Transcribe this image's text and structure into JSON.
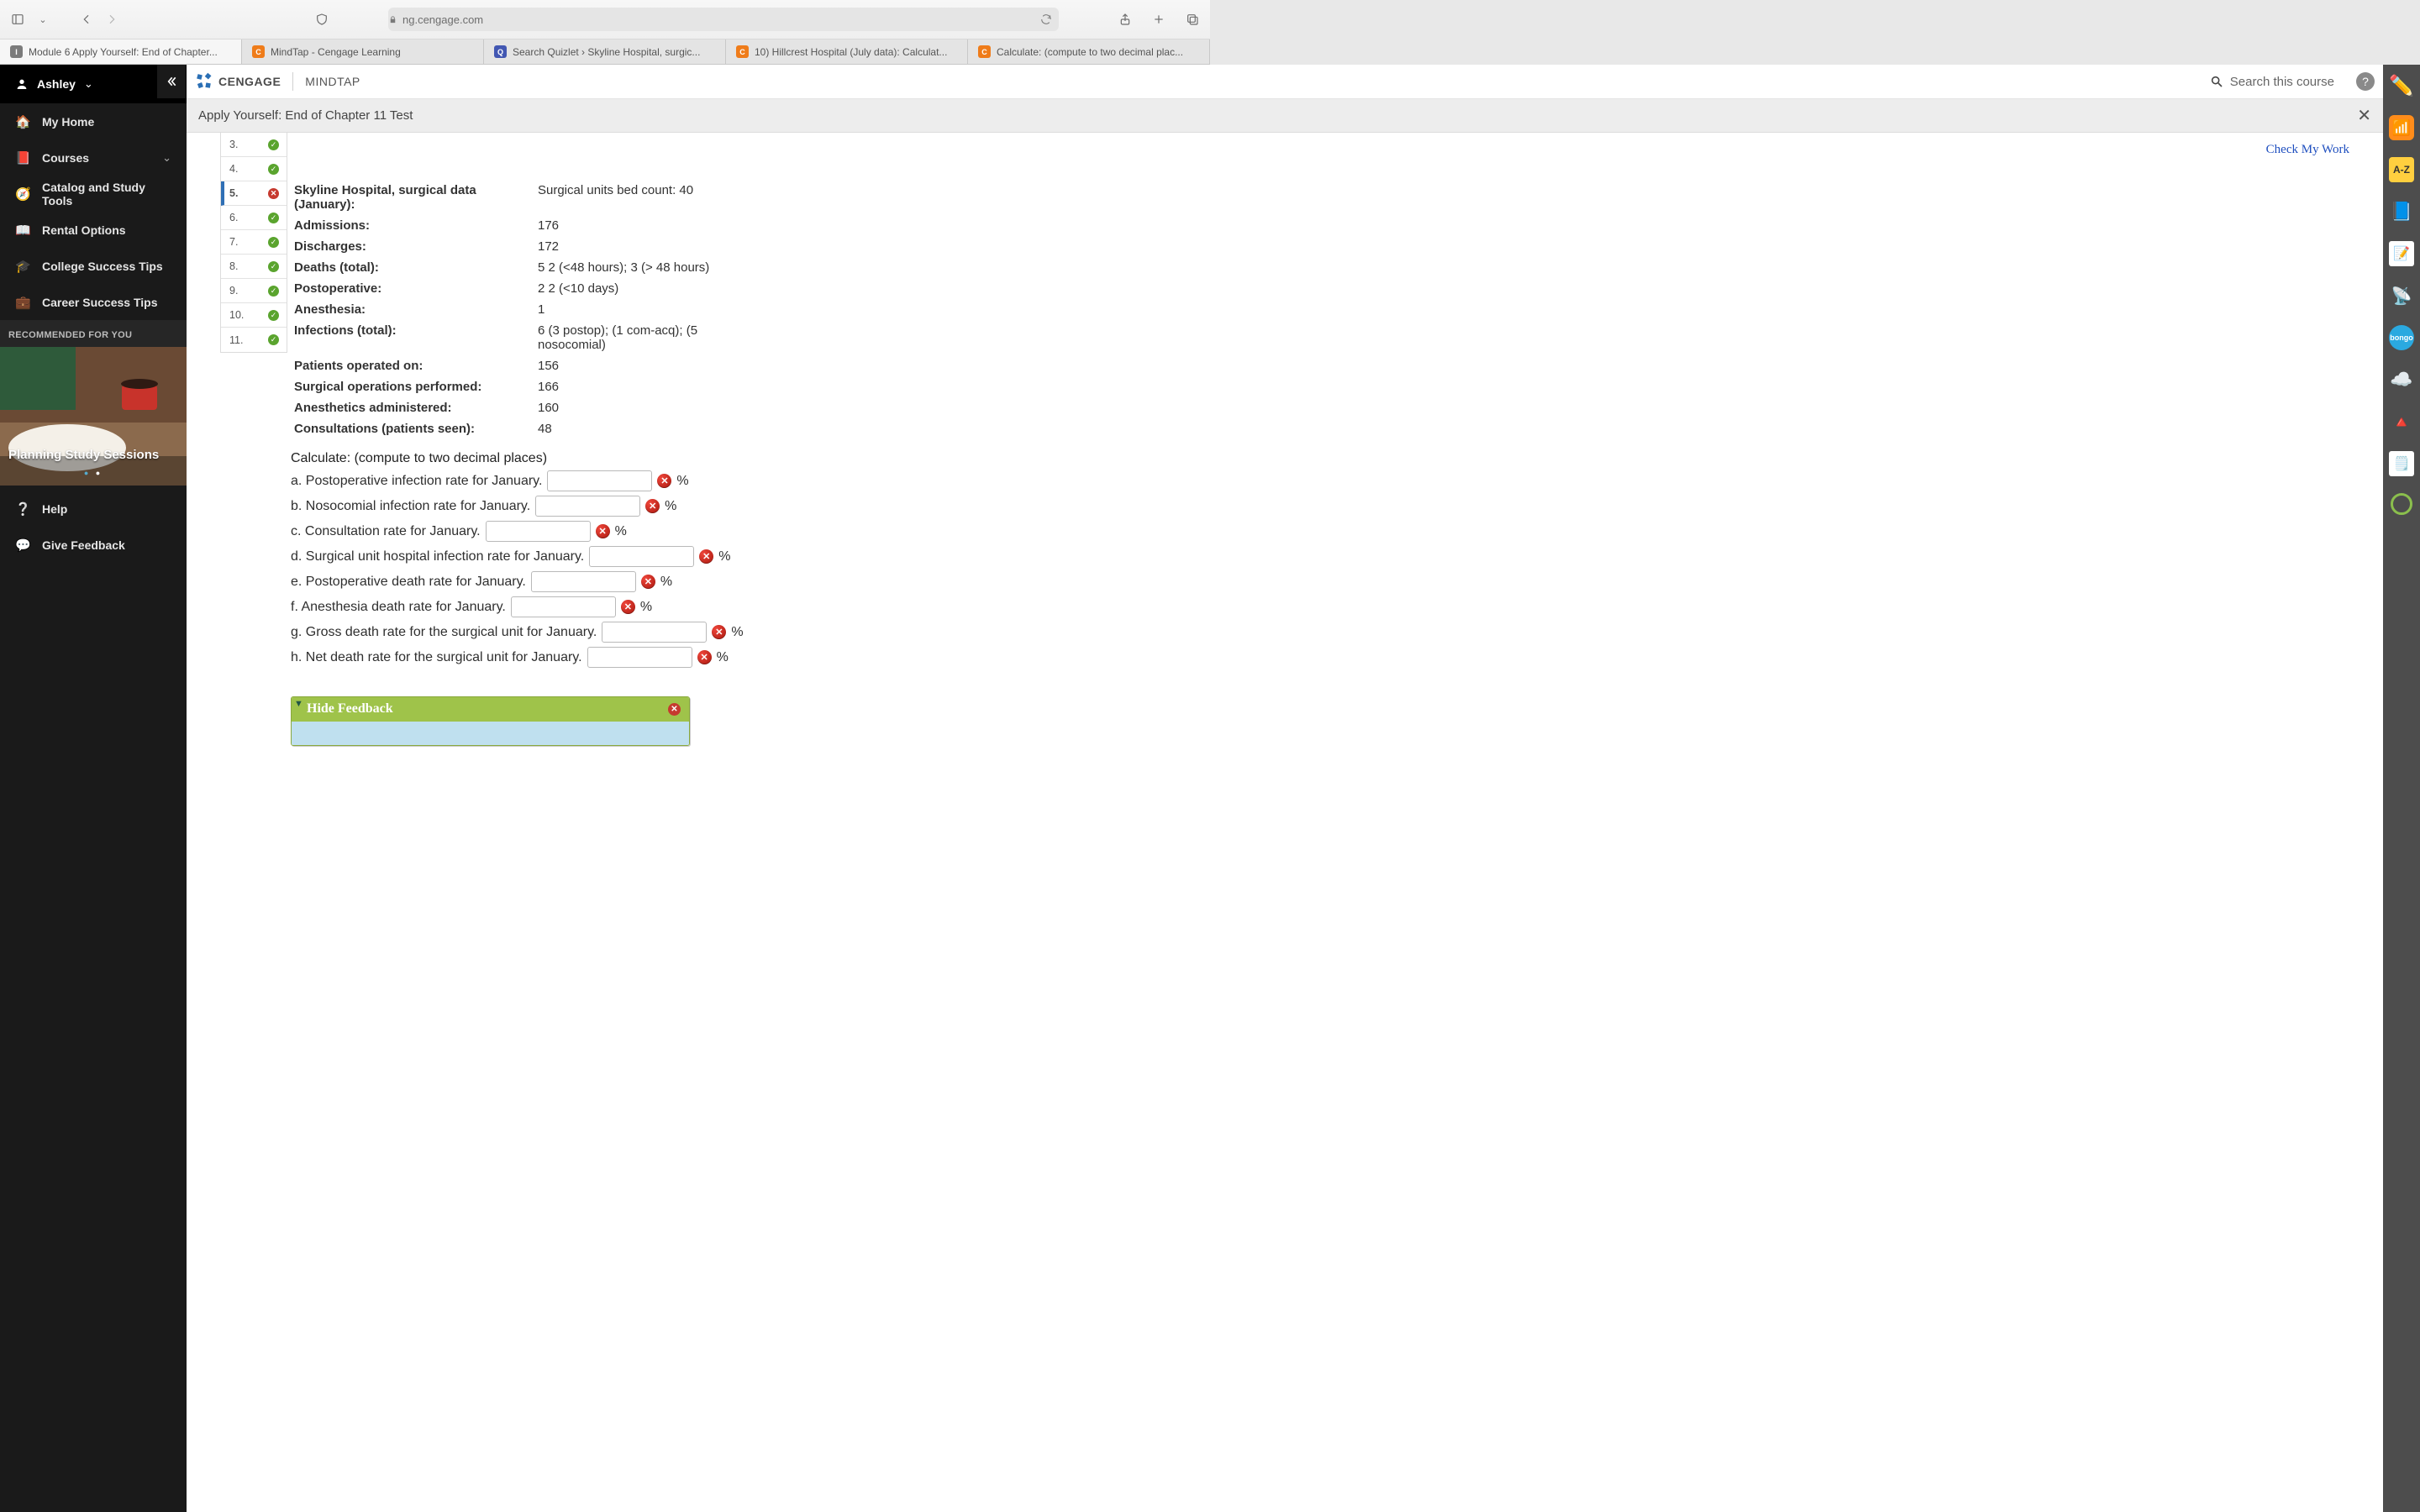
{
  "browser": {
    "url_host": "ng.cengage.com",
    "tabs": [
      {
        "label": "Module 6 Apply Yourself: End of Chapter...",
        "fav": "i"
      },
      {
        "label": "MindTap - Cengage Learning",
        "fav": "c"
      },
      {
        "label": "Search Quizlet › Skyline Hospital, surgic...",
        "fav": "q"
      },
      {
        "label": "10) Hillcrest Hospital (July data): Calculat...",
        "fav": "c"
      },
      {
        "label": "Calculate: (compute to two decimal plac...",
        "fav": "c"
      }
    ],
    "active_tab": 0
  },
  "user": {
    "name": "Ashley"
  },
  "sidebar": {
    "items": [
      {
        "label": "My Home",
        "icon": "home"
      },
      {
        "label": "Courses",
        "icon": "book",
        "chevron": true
      },
      {
        "label": "Catalog and Study Tools",
        "icon": "compass"
      },
      {
        "label": "Rental Options",
        "icon": "open-book"
      },
      {
        "label": "College Success Tips",
        "icon": "gradcap"
      },
      {
        "label": "Career Success Tips",
        "icon": "briefcase"
      }
    ],
    "rec_header": "RECOMMENDED FOR YOU",
    "rec_title": "Planning Study Sessions",
    "lower": [
      {
        "label": "Help",
        "icon": "help"
      },
      {
        "label": "Give Feedback",
        "icon": "feedback"
      }
    ]
  },
  "header": {
    "brand1": "CENGAGE",
    "brand2": "MINDTAP",
    "search_placeholder": "Search this course"
  },
  "assignment_title": "Apply Yourself: End of Chapter 11 Test",
  "check_my_work": "Check My Work",
  "question_nav": [
    {
      "n": "3.",
      "status": "ok"
    },
    {
      "n": "4.",
      "status": "ok"
    },
    {
      "n": "5.",
      "status": "bad",
      "current": true
    },
    {
      "n": "6.",
      "status": "ok"
    },
    {
      "n": "7.",
      "status": "ok"
    },
    {
      "n": "8.",
      "status": "ok"
    },
    {
      "n": "9.",
      "status": "ok"
    },
    {
      "n": "10.",
      "status": "ok"
    },
    {
      "n": "11.",
      "status": "ok"
    }
  ],
  "scenario": {
    "title": "Skyline Hospital, surgical data (January):",
    "bed_count": "Surgical units bed count: 40",
    "rows": [
      {
        "label": "Admissions:",
        "value": "176"
      },
      {
        "label": "Discharges:",
        "value": "172"
      },
      {
        "label": "Deaths (total):",
        "value": "5 2 (<48 hours); 3 (> 48 hours)"
      },
      {
        "label": "Postoperative:",
        "value": "2 2 (<10 days)"
      },
      {
        "label": "Anesthesia:",
        "value": "1"
      },
      {
        "label": "Infections (total):",
        "value": "6 (3 postop); (1 com-acq); (5 nosocomial)"
      },
      {
        "label": "Patients operated on:",
        "value": "156"
      },
      {
        "label": "Surgical operations performed:",
        "value": "166"
      },
      {
        "label": "Anesthetics administered:",
        "value": "160"
      },
      {
        "label": "Consultations (patients seen):",
        "value": "48"
      }
    ]
  },
  "calc_prompt": "Calculate: (compute to two decimal places)",
  "calc_items": [
    {
      "text": "a. Postoperative infection rate for January."
    },
    {
      "text": "b. Nosocomial infection rate for January."
    },
    {
      "text": "c. Consultation rate for January."
    },
    {
      "text": "d. Surgical unit hospital infection rate for January."
    },
    {
      "text": "e. Postoperative death rate for January."
    },
    {
      "text": "f. Anesthesia death rate for January."
    },
    {
      "text": "g. Gross death rate for the surgical unit for January."
    },
    {
      "text": "h. Net death rate for the surgical unit for January."
    }
  ],
  "percent_sign": "%",
  "feedback": {
    "title": "Hide Feedback"
  },
  "chart_data": {
    "type": "table",
    "title": "Skyline Hospital, surgical data (January)",
    "bed_count": 40,
    "admissions": 176,
    "discharges": 172,
    "deaths_total": 5,
    "deaths_lt_48h": 2,
    "deaths_gt_48h": 3,
    "postop_deaths": 2,
    "postop_deaths_lt_10d": 2,
    "anesthesia_deaths": 1,
    "infections_total": 6,
    "infections_postop": 3,
    "infections_community_acquired": 1,
    "infections_nosocomial": 5,
    "patients_operated_on": 156,
    "surgical_operations_performed": 166,
    "anesthetics_administered": 160,
    "consultations_patients_seen": 48
  }
}
